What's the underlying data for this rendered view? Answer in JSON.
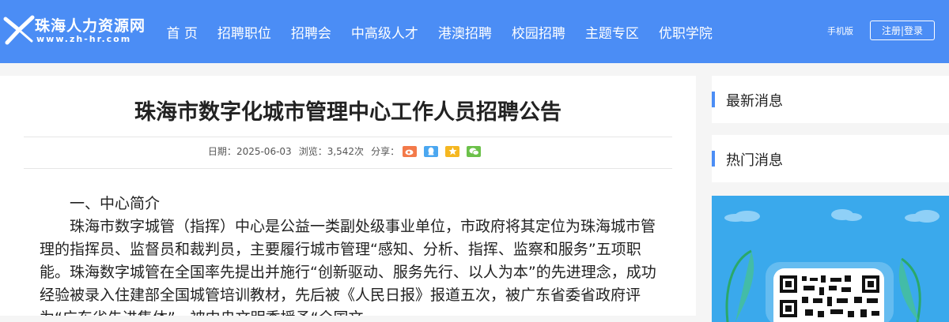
{
  "header": {
    "logo": {
      "name": "珠海人力资源网",
      "url": "www.zh-hr.com"
    },
    "nav": [
      "首 页",
      "招聘职位",
      "招聘会",
      "中高级人才",
      "港澳招聘",
      "校园招聘",
      "主题专区",
      "优职学院"
    ],
    "mobile_label": "手机版",
    "auth_label": "注册|登录"
  },
  "article": {
    "title": "珠海市数字化城市管理中心工作人员招聘公告",
    "date_label": "日期：",
    "date": "2025-06-03",
    "views_label": "浏览：",
    "views": "3,542次",
    "share_label": "分享：",
    "share_icons": [
      "weibo-icon",
      "qq-icon",
      "qzone-icon",
      "wechat-icon"
    ],
    "share_colors": [
      "#f37a4a",
      "#4ba7f0",
      "#f5b721",
      "#6cc14a"
    ],
    "section_heading": "一、中心简介",
    "paragraph": "珠海市数字城管（指挥）中心是公益一类副处级事业单位，市政府将其定位为珠海城市管理的指挥员、监督员和裁判员，主要履行城市管理“感知、分析、指挥、监察和服务”五项职能。珠海数字城管在全国率先提出并施行“创新驱动、服务先行、以人为本”的先进理念，成功经验被录入住建部全国城管培训教材，先后被《人民日报》报道五次，被广东省委省政府评为“广东省先进集体”，被中央文明委授予“全国文"
  },
  "sidebar": {
    "latest_title": "最新消息",
    "hot_title": "热门消息"
  },
  "colors": {
    "brand": "#4b8df5",
    "banner": "#3aa9ec"
  }
}
